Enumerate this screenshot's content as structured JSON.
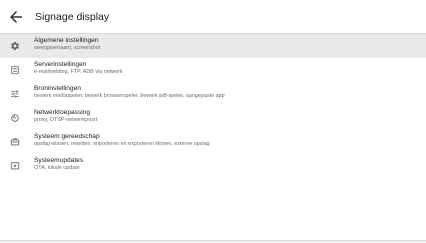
{
  "header": {
    "title": "Signage display",
    "back_icon": "arrow-back-icon"
  },
  "menu": {
    "items": [
      {
        "label": "Algemene instellingen",
        "subtitle": "weergavenaam, screenshot",
        "icon": "gear-icon",
        "selected": true
      },
      {
        "label": "Serverinstellingen",
        "subtitle": "e-mailmelding, FTP, ADB via netwerk",
        "icon": "server-icon",
        "selected": false
      },
      {
        "label": "Broninstellingen",
        "subtitle": "bewerk mediaspeler, bewerk browserspeler, bewerk pdf-speler, aangepaste app",
        "icon": "sliders-icon",
        "selected": false
      },
      {
        "label": "Netwerktoepassing",
        "subtitle": "proxy, OTSP-netwerkpoort",
        "icon": "network-icon",
        "selected": false
      },
      {
        "label": "Systeem gereedschap",
        "subtitle": "opslag wissen, resetten, importeren en exporteren klonen, externe opslag",
        "icon": "toolbox-icon",
        "selected": false
      },
      {
        "label": "Systeemupdates",
        "subtitle": "OTA, lokale update",
        "icon": "system-update-icon",
        "selected": false
      }
    ]
  },
  "colors": {
    "selected_background": "#e9e9e9",
    "subtitle_text": "#6d6d6d",
    "primary_text": "#202124"
  }
}
